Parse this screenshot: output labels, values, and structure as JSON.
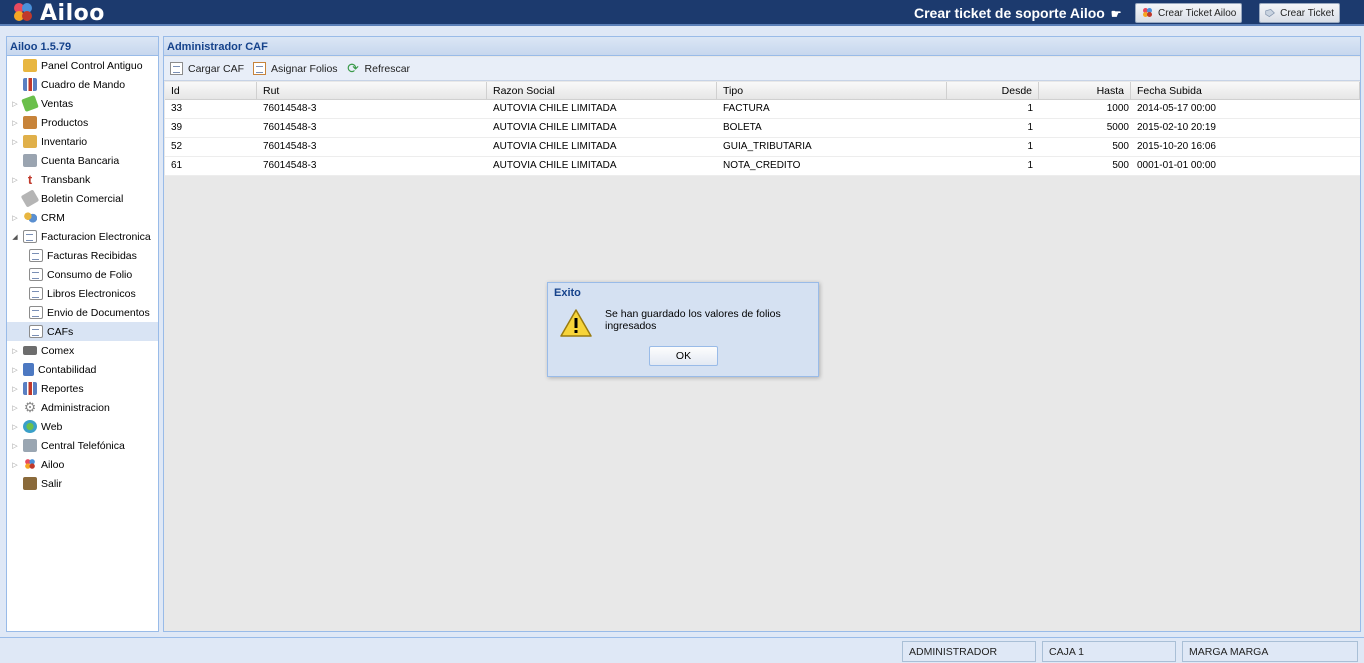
{
  "header": {
    "app_name": "Ailoo",
    "support_title": "Crear ticket de soporte Ailoo",
    "support_hand": "☛",
    "btn_ticket_ailoo": "Crear Ticket Ailoo",
    "btn_ticket": "Crear Ticket"
  },
  "sidebar": {
    "title": "Ailoo 1.5.79",
    "items": [
      {
        "label": "Panel Control Antiguo",
        "icon": "folder-icon",
        "color": "#e8b640"
      },
      {
        "label": "Cuadro de Mando",
        "icon": "bar-chart-icon",
        "color": "#5a7fc2"
      },
      {
        "label": "Ventas",
        "icon": "ticket-icon",
        "color": "#6abf4b"
      },
      {
        "label": "Productos",
        "icon": "box-icon",
        "color": "#c7833a"
      },
      {
        "label": "Inventario",
        "icon": "package-icon",
        "color": "#e0b04a"
      },
      {
        "label": "Cuenta Bancaria",
        "icon": "bank-icon",
        "color": "#9aa4b0"
      },
      {
        "label": "Transbank",
        "icon": "transbank-icon",
        "color": "#c0392b"
      },
      {
        "label": "Boletin Comercial",
        "icon": "tag-icon",
        "color": "#a0a0a0"
      },
      {
        "label": "CRM",
        "icon": "crm-icon",
        "color": "#5a8fd0"
      },
      {
        "label": "Facturacion Electronica",
        "icon": "document-icon",
        "color": "#ffffff"
      },
      {
        "label": "Facturas Recibidas",
        "icon": "document-icon",
        "color": "#ffffff"
      },
      {
        "label": "Consumo de Folio",
        "icon": "document-icon",
        "color": "#ffffff"
      },
      {
        "label": "Libros Electronicos",
        "icon": "document-icon",
        "color": "#ffffff"
      },
      {
        "label": "Envio de Documentos",
        "icon": "document-icon",
        "color": "#ffffff"
      },
      {
        "label": "CAFs",
        "icon": "document-icon",
        "color": "#ffffff"
      },
      {
        "label": "Comex",
        "icon": "truck-icon",
        "color": "#6d6d6d"
      },
      {
        "label": "Contabilidad",
        "icon": "calculator-icon",
        "color": "#4d79c2"
      },
      {
        "label": "Reportes",
        "icon": "report-icon",
        "color": "#5a7fc2"
      },
      {
        "label": "Administracion",
        "icon": "gear-icon",
        "color": "#8a8a8a"
      },
      {
        "label": "Web",
        "icon": "globe-icon",
        "color": "#3aa0c8"
      },
      {
        "label": "Central Telefónica",
        "icon": "phone-icon",
        "color": "#7a8a9a"
      },
      {
        "label": "Ailoo",
        "icon": "ailoo-logo-icon",
        "color": "#d9334a"
      },
      {
        "label": "Salir",
        "icon": "exit-door-icon",
        "color": "#8a6a3a"
      }
    ]
  },
  "main": {
    "title": "Administrador CAF",
    "toolbar": {
      "cargar": "Cargar CAF",
      "asignar": "Asignar Folios",
      "refrescar": "Refrescar"
    },
    "columns": [
      "Id",
      "Rut",
      "Razon Social",
      "Tipo",
      "Desde",
      "Hasta",
      "Fecha Subida"
    ],
    "rows": [
      {
        "id": "33",
        "rut": "76014548-3",
        "razon": "AUTOVIA CHILE LIMITADA",
        "tipo": "FACTURA",
        "desde": "1",
        "hasta": "1000",
        "fecha": "2014-05-17 00:00"
      },
      {
        "id": "39",
        "rut": "76014548-3",
        "razon": "AUTOVIA CHILE LIMITADA",
        "tipo": "BOLETA",
        "desde": "1",
        "hasta": "5000",
        "fecha": "2015-02-10 20:19"
      },
      {
        "id": "52",
        "rut": "76014548-3",
        "razon": "AUTOVIA CHILE LIMITADA",
        "tipo": "GUIA_TRIBUTARIA",
        "desde": "1",
        "hasta": "500",
        "fecha": "2015-10-20 16:06"
      },
      {
        "id": "61",
        "rut": "76014548-3",
        "razon": "AUTOVIA CHILE LIMITADA",
        "tipo": "NOTA_CREDITO",
        "desde": "1",
        "hasta": "500",
        "fecha": "0001-01-01 00:00"
      }
    ]
  },
  "dialog": {
    "title": "Exito",
    "message": "Se han guardado los valores de folios ingresados",
    "ok": "OK"
  },
  "statusbar": {
    "user": "ADMINISTRADOR",
    "caja": "CAJA 1",
    "branch": "MARGA MARGA"
  }
}
